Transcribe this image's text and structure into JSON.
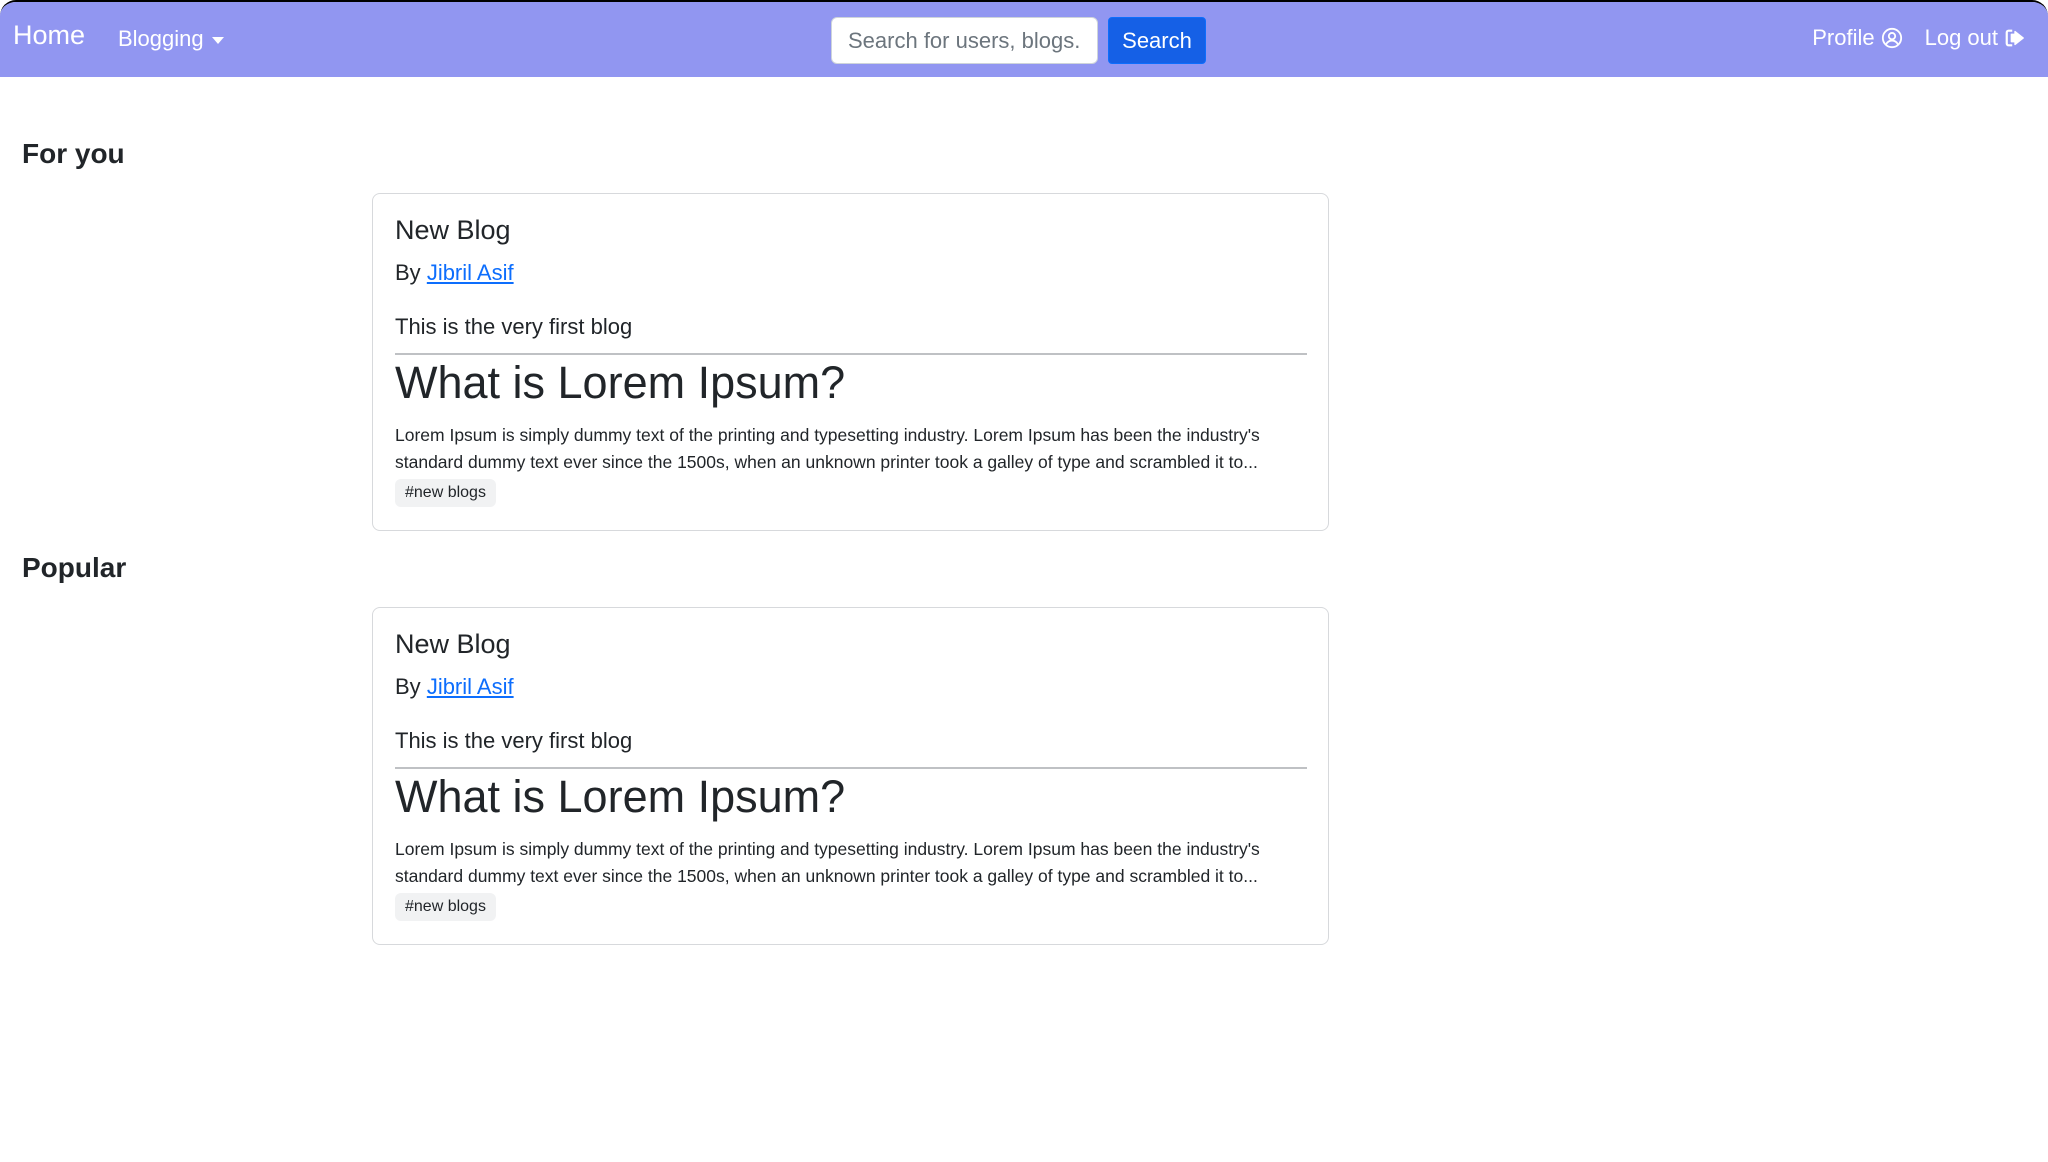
{
  "navbar": {
    "brand": "Home",
    "dropdown_label": "Blogging",
    "search_placeholder": "Search for users, blogs..",
    "search_button": "Search",
    "profile_label": "Profile",
    "logout_label": "Log out",
    "background": "#9196f1"
  },
  "sections": [
    {
      "title": "For you",
      "card": {
        "title": "New Blog",
        "by_prefix": "By",
        "author": "Jibril Asif",
        "subtitle": "This is the very first blog",
        "heading": "What is Lorem Ipsum?",
        "excerpt": "Lorem Ipsum is simply dummy text of the printing and typesetting industry. Lorem Ipsum has been the industry's standard dummy text ever since the 1500s, when an unknown printer took a galley of type and scrambled it to...",
        "tag": "#new blogs"
      }
    },
    {
      "title": "Popular",
      "card": {
        "title": "New Blog",
        "by_prefix": "By",
        "author": "Jibril Asif",
        "subtitle": "This is the very first blog",
        "heading": "What is Lorem Ipsum?",
        "excerpt": "Lorem Ipsum is simply dummy text of the printing and typesetting industry. Lorem Ipsum has been the industry's standard dummy text ever since the 1500s, when an unknown printer took a galley of type and scrambled it to...",
        "tag": "#new blogs"
      }
    }
  ],
  "colors": {
    "link": "#0d6efd",
    "search_button": "#1560e6"
  },
  "icons": {
    "profile": "user-circle-icon",
    "logout": "sign-out-icon",
    "dropdown": "caret-down-icon"
  }
}
